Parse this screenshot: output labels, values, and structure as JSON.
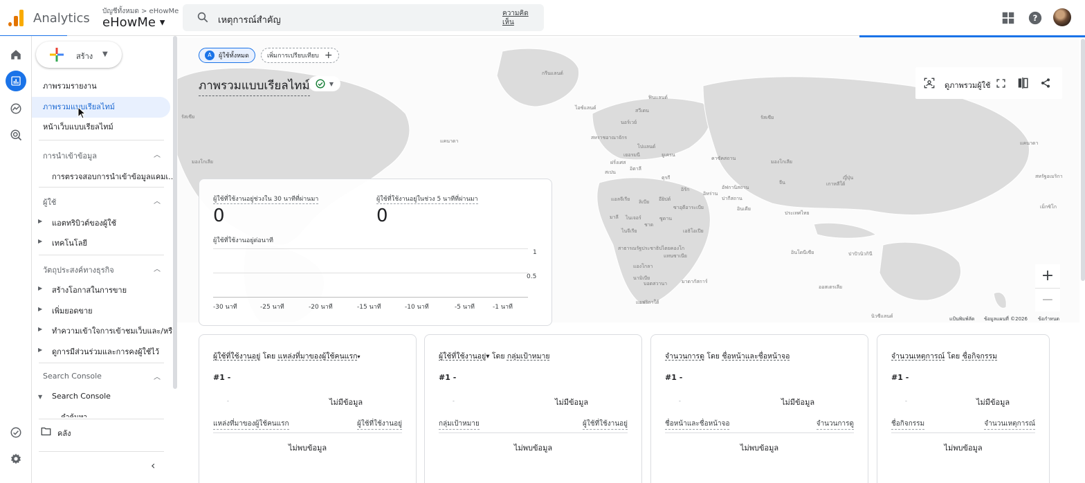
{
  "header": {
    "app_name": "Analytics",
    "account_path": "บัญชีทั้งหมด > eHowMe",
    "property_name": "eHowMe",
    "search_text": "เหตุการณ์สำคัญ",
    "feedback_label": "ความคิดเห็น",
    "icons": [
      "apps-grid-icon",
      "help-icon",
      "avatar"
    ]
  },
  "rail": {
    "items": [
      "home-icon",
      "reports-icon",
      "explore-icon",
      "advertising-icon"
    ],
    "bottom": [
      "admin-check-icon",
      "settings-gear-icon"
    ]
  },
  "sidebar": {
    "create_label": "สร้าง",
    "items": {
      "reports_snapshot": "ภาพรวมรายงาน",
      "realtime_overview": "ภาพรวมแบบเรียลไทม์",
      "realtime_pages": "หน้าเว็บแบบเรียลไทม์"
    },
    "sections": {
      "data_import": "การนำเข้าข้อมูล",
      "data_import_sub": "การตรวจสอบการนำเข้าข้อมูลแคมเ...",
      "user": "ผู้ใช้",
      "user_attributes": "แอตทริบิวต์ของผู้ใช้",
      "tech": "เทคโนโลยี",
      "business": "วัตถุประสงค์ทางธุรกิจ",
      "leads": "สร้างโอกาสในการขาย",
      "sales": "เพิ่มยอดขาย",
      "understand": "ทำความเข้าใจการเข้าชมเว็บและ/หรื...",
      "engagement": "ดูการมีส่วนร่วมและการคงผู้ใช้ไว้",
      "search_console": "Search Console",
      "search_console_sub": "Search Console",
      "queries": "คำค้นหา"
    },
    "library_label": "คลัง"
  },
  "main": {
    "chip_all_users": "ผู้ใช้ทั้งหมด",
    "chip_all_users_badge": "A",
    "chip_compare": "เพิ่มการเปรียบเทียบ",
    "page_title": "ภาพรวมแบบเรียลไทม์",
    "map_tools": {
      "audience_label": "ดูภาพรวมผู้ใช้"
    },
    "map_footer": {
      "shortcuts": "แป้นพิมพ์ลัด",
      "map_data": "ข้อมูลแผนที่ ©2026",
      "terms": "ข้อกำหนด"
    },
    "map_labels": [
      "กรีนแลนด์",
      "ฟินแลนด์",
      "ไอซ์แลนด์",
      "สวีเดน",
      "นอร์เวย์",
      "รัสเซีย",
      "สหราชอาณาจักร",
      "โปแลนด์",
      "ยูเครน",
      "เยอรมนี",
      "ฝรั่งเศส",
      "สเปน",
      "อิตาลี",
      "ตุรกี",
      "คาซัคสถาน",
      "มองโกเลีย",
      "จีน",
      "ญี่ปุ่น",
      "เกาหลีใต้",
      "อิหร่าน",
      "อัฟกานิสถาน",
      "อิรัก",
      "ปากีสถาน",
      "อินเดีย",
      "แอลจีเรีย",
      "ลิเบีย",
      "อียิปต์",
      "ซาอุดีอาระเบีย",
      "มาลี",
      "ไนเจอร์",
      "ชาด",
      "ซูดาน",
      "เอธิโอเปีย",
      "ไนจีเรีย",
      "ประเทศไทย",
      "สาธารณรัฐประชาธิปไตยคองโก",
      "แทนซาเนีย",
      "แองโกลา",
      "นามิเบีย",
      "บอตสวานา",
      "มาดากัสการ์",
      "แอฟริกาใต้",
      "อินโดนีเซีย",
      "ปาปัวนิวกินี",
      "ออสเตรเลีย",
      "นิวซีแลนด์",
      "แคนาดา",
      "มองโกเลีย",
      "แคนาดา",
      "สหรัฐอเมริกา",
      "เม็กซิโก",
      "รัสเซีย"
    ],
    "realtime": {
      "label_30min": "ผู้ใช้ที่ใช้งานอยู่ช่วงใน 30 นาทีที่ผ่านมา",
      "value_30min": "0",
      "label_5min": "ผู้ใช้ที่ใช้งานอยู่ในช่วง 5 นาทีที่ผ่านมา",
      "value_5min": "0",
      "per_minute_label": "ผู้ใช้ที่ใช้งานอยู่ต่อนาที",
      "y_ticks": [
        "1",
        "0.5"
      ],
      "x_ticks": [
        "-30 นาที",
        "-25 นาที",
        "-20 นาที",
        "-15 นาที",
        "-10 นาที",
        "-5 นาที",
        "-1 นาที"
      ]
    },
    "cards": [
      {
        "title_metric": "ผู้ใช้ที่ใช้งานอยู่",
        "title_by": " โดย ",
        "title_dimension": "แหล่งที่มาของผู้ใช้คนแรก",
        "title_caret": "▾",
        "rank": "#1  -",
        "dash": "-",
        "no_data": "ไม่มีข้อมูล",
        "col1": "แหล่งที่มาของผู้ใช้คนแรก",
        "col2": "ผู้ใช้ที่ใช้งานอยู่",
        "not_found": "ไม่พบข้อมูล"
      },
      {
        "title_metric": "ผู้ใช้ที่ใช้งานอยู่",
        "title_by": "▾ โดย ",
        "title_dimension": "กลุ่มเป้าหมาย",
        "title_caret": "",
        "rank": "#1  -",
        "dash": "-",
        "no_data": "ไม่มีข้อมูล",
        "col1": "กลุ่มเป้าหมาย",
        "col2": "ผู้ใช้ที่ใช้งานอยู่",
        "not_found": "ไม่พบข้อมูล"
      },
      {
        "title_metric": "จำนวนการดู",
        "title_by": " โดย ",
        "title_dimension": "ชื่อหน้าและชื่อหน้าจอ",
        "title_caret": "",
        "rank": "#1  -",
        "dash": "-",
        "no_data": "ไม่มีข้อมูล",
        "col1": "ชื่อหน้าและชื่อหน้าจอ",
        "col2": "จำนวนการดู",
        "not_found": "ไม่พบข้อมูล"
      },
      {
        "title_metric": "จำนวนเหตุการณ์",
        "title_by": " โดย ",
        "title_dimension": "ชื่อกิจกรรม",
        "title_caret": "",
        "rank": "#1  -",
        "dash": "-",
        "no_data": "ไม่มีข้อมูล",
        "col1": "ชื่อกิจกรรม",
        "col2": "จำนวนเหตุการณ์",
        "not_found": "ไม่พบข้อมูล"
      }
    ]
  },
  "colors": {
    "accent": "#1a73e8",
    "logo_orange": "#e37400",
    "logo_yellow": "#f9ab00",
    "selected_bg": "#e8f0fe"
  }
}
